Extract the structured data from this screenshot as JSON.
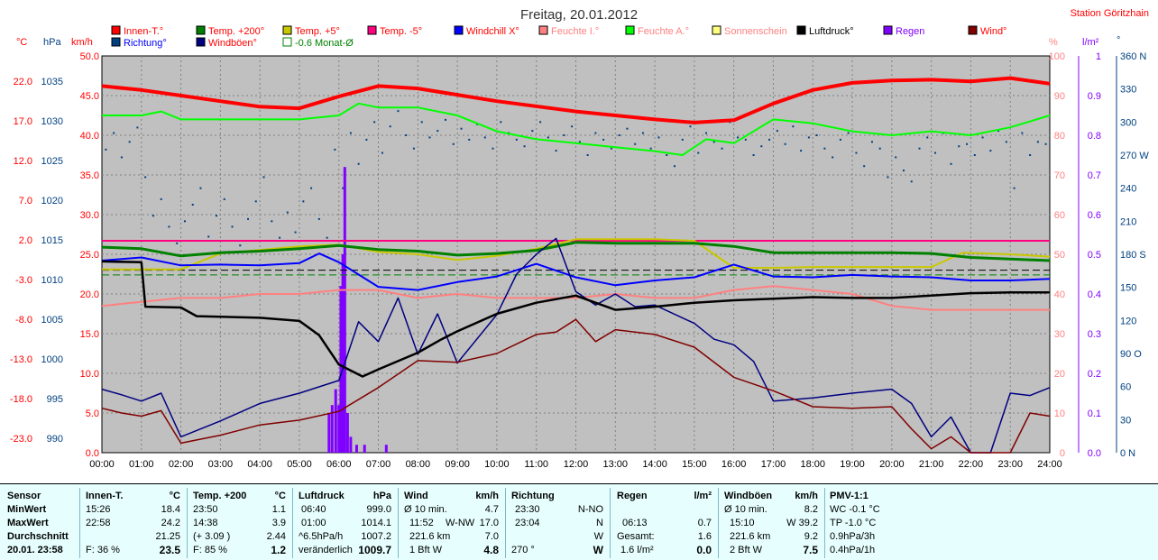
{
  "header": {
    "title": "Freitag, 20.01.2012",
    "station": "Station Göritzhain"
  },
  "colors": {
    "innen": "#ff0000",
    "temp200": "#008000",
    "temp5": "#c8c800",
    "temp_minus5": "#ff0080",
    "windchill": "#0000ff",
    "feuchte_i": "#ff8080",
    "feuchte_a": "#00ff00",
    "sonne": "#ffff80",
    "luftdruck": "#000000",
    "regen": "#8000ff",
    "wind": "#800000",
    "richtung": "#004080",
    "windboen": "#000080",
    "monat": "#008000",
    "axis_red": "#ff0000",
    "axis_blue": "#0000ff",
    "axis_navy": "#004080",
    "axis_violet": "#8000ff",
    "axis_pink": "#ff8080"
  },
  "legend": [
    {
      "label": "Innen-T.°",
      "color": "#ff0000",
      "text_color": "#ff0000"
    },
    {
      "label": "Temp. +200°",
      "color": "#008000",
      "text_color": "#ff0000"
    },
    {
      "label": "Temp. +5°",
      "color": "#c8c800",
      "text_color": "#ff0000"
    },
    {
      "label": "Temp. -5°",
      "color": "#ff0080",
      "text_color": "#ff0000"
    },
    {
      "label": "Windchill X°",
      "color": "#0000ff",
      "text_color": "#ff0000"
    },
    {
      "label": "Feuchte I.°",
      "color": "#ff8080",
      "text_color": "#ff8080"
    },
    {
      "label": "Feuchte A.°",
      "color": "#00ff00",
      "text_color": "#ff8080"
    },
    {
      "label": "Sonnenschein",
      "color": "#ffff80",
      "text_color": "#ff8080"
    },
    {
      "label": "Luftdruck°",
      "color": "#000000",
      "text_color": "#000000"
    },
    {
      "label": "Regen",
      "color": "#8000ff",
      "text_color": "#8000ff"
    },
    {
      "label": "Wind°",
      "color": "#800000",
      "text_color": "#ff0000"
    },
    {
      "label": "Richtung°",
      "color": "#004080",
      "text_color": "#0000ff"
    },
    {
      "label": "Windböen°",
      "color": "#000080",
      "text_color": "#ff0000"
    },
    {
      "label": "-0.6 Monat-Ø",
      "color": "#008000",
      "text_color": "#008000",
      "hollow": true
    }
  ],
  "unit_labels": {
    "c": "°C",
    "hpa": "hPa",
    "kmh": "km/h",
    "pct": "%",
    "lm2": "l/m²",
    "deg": "°"
  },
  "chart_data": {
    "type": "line",
    "title": "Freitag, 20.01.2012",
    "x_ticks": [
      "00:00",
      "01:00",
      "02:00",
      "03:00",
      "04:00",
      "05:00",
      "06:00",
      "07:00",
      "08:00",
      "09:00",
      "10:00",
      "11:00",
      "12:00",
      "13:00",
      "14:00",
      "15:00",
      "16:00",
      "17:00",
      "18:00",
      "19:00",
      "20:00",
      "21:00",
      "22:00",
      "23:00",
      "24:00"
    ],
    "axes": {
      "temp_c": {
        "min": -23.0,
        "max": 27.0,
        "ticks": [
          "22.0",
          "17.0",
          "12.0",
          "7.0",
          "2.0",
          "-3.0",
          "-8.0",
          "-13.0",
          "-18.0",
          "-23.0"
        ]
      },
      "pressure_hpa": {
        "min": 990,
        "max": 1040,
        "ticks": [
          "1035",
          "1030",
          "1025",
          "1020",
          "1015",
          "1010",
          "1005",
          "1000",
          "995",
          "990"
        ]
      },
      "wind_kmh": {
        "min": 0,
        "max": 50,
        "ticks": [
          "50.0",
          "45.0",
          "40.0",
          "35.0",
          "30.0",
          "25.0",
          "20.0",
          "15.0",
          "10.0",
          "5.0",
          "0.0"
        ]
      },
      "humidity_pct": {
        "min": 0,
        "max": 100,
        "ticks": [
          "100",
          "90",
          "80",
          "70",
          "60",
          "50",
          "40",
          "30",
          "20",
          "10",
          "0"
        ]
      },
      "rain_lm2": {
        "min": 0,
        "max": 1.0,
        "ticks": [
          "1",
          "0.9",
          "0.8",
          "0.7",
          "0.6",
          "0.5",
          "0.4",
          "0.3",
          "0.2",
          "0.1",
          "0.0"
        ]
      },
      "direction_deg": {
        "min": 0,
        "max": 360,
        "ticks": [
          "360 N",
          "330",
          "300",
          "270 W",
          "240",
          "210",
          "180 S",
          "150",
          "120",
          "90 O",
          "60",
          "30",
          "0 N"
        ]
      }
    },
    "series": [
      {
        "name": "Innen-T.°",
        "axis": "temp_c",
        "x": [
          0,
          1,
          2,
          3,
          4,
          5,
          6,
          7,
          8,
          10,
          12,
          14,
          15,
          16,
          17,
          18,
          19,
          20,
          21,
          22,
          23,
          24
        ],
        "y": [
          23.2,
          22.7,
          22.0,
          21.3,
          20.6,
          20.4,
          21.9,
          23.2,
          22.9,
          21.3,
          20.0,
          19.0,
          18.6,
          18.9,
          21.0,
          22.7,
          23.6,
          23.9,
          24.0,
          23.8,
          24.2,
          23.5
        ]
      },
      {
        "name": "Feuchte A.°",
        "axis": "humidity_pct",
        "x": [
          0,
          1,
          1.5,
          2,
          3,
          4,
          5,
          6,
          6.5,
          7,
          8,
          9,
          10,
          11,
          12,
          13,
          14,
          14.7,
          15.3,
          16,
          17,
          18,
          19,
          20,
          21,
          22,
          23,
          24
        ],
        "y": [
          85,
          85,
          86,
          84,
          84,
          84,
          84,
          85,
          88,
          87,
          87,
          85,
          81,
          79,
          78,
          77,
          76,
          75,
          79,
          78,
          84,
          83,
          81,
          80,
          81,
          80,
          82,
          85
        ]
      },
      {
        "name": "Temp. -5°",
        "axis": "temp_c",
        "x": [
          0,
          24
        ],
        "y": [
          3.7,
          3.7
        ]
      },
      {
        "name": "Temp. +5°",
        "axis": "temp_c",
        "x": [
          0,
          2,
          3,
          5,
          6,
          7,
          8,
          9,
          10,
          11,
          12,
          13,
          14,
          15,
          16,
          17,
          18,
          19,
          20,
          21,
          21.8,
          23,
          24
        ],
        "y": [
          0.1,
          0.1,
          2.1,
          3.0,
          3.2,
          2.3,
          2.0,
          1.3,
          1.8,
          2.7,
          3.9,
          3.9,
          3.9,
          3.7,
          0.3,
          0.3,
          0.4,
          0.4,
          0.4,
          0.4,
          2.2,
          2.0,
          1.7
        ]
      },
      {
        "name": "Temp. +200°",
        "axis": "temp_c",
        "x": [
          0,
          1,
          2,
          3,
          4,
          5,
          6,
          7,
          8,
          9,
          10,
          11,
          12,
          13,
          14,
          15,
          16,
          17,
          18,
          19,
          20,
          21,
          22,
          23,
          24
        ],
        "y": [
          2.9,
          2.7,
          1.8,
          2.2,
          2.4,
          2.7,
          3.1,
          2.6,
          2.4,
          1.9,
          2.1,
          2.5,
          3.5,
          3.4,
          3.4,
          3.4,
          3.0,
          2.2,
          2.2,
          2.2,
          2.2,
          2.1,
          1.6,
          1.4,
          1.2
        ]
      },
      {
        "name": "Windchill X°",
        "axis": "temp_c",
        "x": [
          0,
          1,
          2,
          3,
          4,
          5,
          5.5,
          6,
          7,
          8,
          9,
          10,
          11,
          12,
          13,
          14,
          15,
          16,
          17,
          18,
          19,
          20,
          21,
          22,
          23,
          24
        ],
        "y": [
          1.2,
          1.6,
          0.6,
          0.7,
          0.6,
          0.9,
          2.1,
          1.0,
          -2.1,
          -2.5,
          -1.5,
          -0.8,
          0.8,
          -0.9,
          -1.9,
          -1.3,
          -0.9,
          0.7,
          -0.8,
          -0.9,
          -0.6,
          -0.8,
          -0.9,
          -1.3,
          -1.3,
          -1.1
        ]
      },
      {
        "name": "Feuchte I.°",
        "axis": "humidity_pct",
        "x": [
          0,
          1,
          2,
          3,
          4,
          5,
          6,
          7,
          8,
          9,
          10,
          11,
          12,
          13,
          14,
          15,
          16,
          17,
          18,
          19,
          20,
          21,
          22,
          23,
          24
        ],
        "y": [
          37,
          38,
          39,
          39,
          40,
          40,
          41,
          41,
          39,
          40,
          39,
          39,
          39,
          40,
          39,
          39,
          41,
          42,
          41,
          40,
          37,
          36,
          36,
          36,
          36
        ]
      },
      {
        "name": "Luftdruck°",
        "axis": "pressure_hpa",
        "x": [
          0,
          1,
          1.1,
          2,
          2.4,
          4,
          5,
          5.5,
          6,
          6.6,
          7,
          8,
          8.6,
          9,
          10,
          11,
          12,
          13,
          14,
          15,
          16,
          17,
          18,
          19,
          20,
          21,
          22,
          23,
          24
        ],
        "y": [
          1014.1,
          1014.0,
          1008.4,
          1008.3,
          1007.2,
          1007.0,
          1006.6,
          1004.8,
          1001.1,
          999.6,
          1000.5,
          1002.6,
          1004.3,
          1005.3,
          1007.5,
          1008.9,
          1009.8,
          1008.0,
          1008.4,
          1008.9,
          1009.2,
          1009.4,
          1009.6,
          1009.5,
          1009.5,
          1009.8,
          1010.1,
          1010.2,
          1010.2
        ]
      },
      {
        "name": "Wind°",
        "axis": "wind_kmh",
        "x": [
          0,
          0.5,
          1,
          1.5,
          2,
          3,
          4,
          5,
          6,
          7,
          8,
          9,
          10,
          11,
          11.5,
          12,
          12.5,
          13,
          14,
          15,
          16,
          17,
          18,
          19,
          20,
          20.5,
          21,
          21.5,
          22,
          22.5,
          23,
          23.5,
          24
        ],
        "y": [
          5.6,
          5.0,
          4.6,
          5.3,
          1.2,
          2.2,
          3.5,
          4.1,
          5.2,
          8.2,
          11.6,
          11.4,
          12.5,
          14.9,
          15.2,
          16.8,
          14.0,
          15.5,
          14.9,
          13.3,
          9.5,
          7.8,
          5.8,
          5.6,
          5.8,
          3.0,
          0.5,
          2.0,
          0.0,
          0.0,
          0.0,
          5.0,
          4.6
        ]
      },
      {
        "name": "Windböen°",
        "axis": "wind_kmh",
        "x": [
          0,
          0.5,
          1,
          1.5,
          2,
          3,
          4,
          5,
          6,
          6.5,
          7,
          7.5,
          8,
          8.5,
          9,
          10,
          10.5,
          11,
          11.5,
          12,
          12.5,
          13,
          13.5,
          14,
          15,
          15.5,
          16,
          16.5,
          17,
          18,
          19,
          20,
          20.5,
          21,
          21.5,
          22,
          22.5,
          23,
          23.5,
          24
        ],
        "y": [
          8.0,
          7.3,
          6.5,
          7.5,
          2.0,
          4.0,
          6.2,
          7.5,
          9.1,
          16.5,
          14.0,
          19.5,
          12.4,
          17.5,
          11.3,
          17.4,
          22.5,
          25.0,
          27.0,
          20.3,
          18.6,
          20.0,
          18.4,
          18.6,
          16.3,
          14.3,
          13.6,
          11.5,
          6.5,
          6.9,
          7.5,
          8.0,
          6.2,
          2.0,
          4.5,
          0.0,
          0.0,
          7.5,
          7.2,
          8.2
        ]
      },
      {
        "name": "Regen",
        "axis": "rain_lm2",
        "type": "bar",
        "x": [
          5.75,
          5.83,
          5.92,
          6.0,
          6.05,
          6.1,
          6.15,
          6.22,
          6.3,
          6.45,
          6.65,
          7.2
        ],
        "y": [
          0.1,
          0.12,
          0.16,
          0.12,
          0.42,
          0.5,
          0.72,
          0.1,
          0.04,
          0.02,
          0.02,
          0.02
        ]
      },
      {
        "name": "-0.6 Monat-Ø",
        "axis": "temp_c",
        "type": "reference",
        "y": -0.6
      }
    ],
    "richtung_x": [
      0.1,
      0.3,
      0.5,
      0.7,
      0.9,
      1.1,
      1.3,
      1.5,
      1.7,
      1.9,
      2.1,
      2.3,
      2.5,
      2.7,
      2.9,
      3.1,
      3.3,
      3.5,
      3.7,
      3.9,
      4.1,
      4.3,
      4.5,
      4.7,
      4.9,
      5.1,
      5.3,
      5.5,
      5.7,
      5.9,
      6.1,
      6.3,
      6.5,
      6.7,
      6.9,
      7.1,
      7.3,
      7.5,
      7.7,
      7.9,
      8.1,
      8.3,
      8.5,
      8.7,
      8.9,
      9.1,
      9.3,
      9.5,
      9.7,
      9.9,
      10.1,
      10.3,
      10.5,
      10.7,
      10.9,
      11.1,
      11.3,
      11.5,
      11.7,
      11.9,
      12.1,
      12.3,
      12.5,
      12.7,
      12.9,
      13.1,
      13.3,
      13.5,
      13.7,
      13.9,
      14.1,
      14.3,
      14.5,
      14.7,
      14.9,
      15.1,
      15.3,
      15.5,
      15.7,
      15.9,
      16.1,
      16.3,
      16.5,
      16.7,
      16.9,
      17.1,
      17.3,
      17.5,
      17.7,
      17.9,
      18.1,
      18.3,
      18.5,
      18.7,
      18.9,
      19.1,
      19.3,
      19.5,
      19.7,
      19.9,
      20.1,
      20.3,
      20.5,
      20.7,
      20.9,
      21.1,
      21.3,
      21.5,
      21.7,
      21.9,
      22.1,
      22.3,
      22.5,
      22.7,
      22.9,
      23.1,
      23.3,
      23.5,
      23.7,
      23.9
    ],
    "richtung_deg": [
      275,
      290,
      268,
      282,
      295,
      250,
      215,
      230,
      205,
      190,
      210,
      225,
      240,
      196,
      215,
      230,
      205,
      188,
      212,
      228,
      250,
      210,
      195,
      218,
      200,
      228,
      240,
      212,
      195,
      275,
      240,
      290,
      262,
      284,
      300,
      272,
      296,
      310,
      288,
      276,
      300,
      286,
      292,
      302,
      280,
      294,
      284,
      298,
      286,
      276,
      300,
      290,
      284,
      278,
      292,
      300,
      286,
      274,
      288,
      296,
      282,
      270,
      290,
      284,
      276,
      288,
      294,
      280,
      290,
      276,
      286,
      270,
      260,
      284,
      296,
      272,
      290,
      282,
      276,
      300,
      286,
      284,
      270,
      278,
      284,
      292,
      280,
      296,
      274,
      286,
      288,
      276,
      268,
      284,
      290,
      272,
      260,
      282,
      276,
      250,
      268,
      256,
      246,
      276,
      286,
      272,
      290,
      262,
      278,
      280,
      270,
      286,
      274,
      292,
      282,
      240,
      290,
      270,
      282,
      280
    ]
  },
  "stats": {
    "sensor": {
      "title": "Sensor",
      "min": "MinWert",
      "max": "MaxWert",
      "avg": "Durchschnitt",
      "now": "20.01. 23:58"
    },
    "innen": {
      "title": "Innen-T.",
      "unit": "°C",
      "min_t": "15:26",
      "min_v": "18.4",
      "max_t": "22:58",
      "max_v": "24.2",
      "avg_v": "21.25",
      "now_l": "F: 36 %",
      "now_v": "23.5"
    },
    "temp200": {
      "title": "Temp. +200",
      "unit": "°C",
      "min_t": "23:50",
      "min_v": "1.1",
      "max_t": "14:38",
      "max_v": "3.9",
      "avg_t": "(+ 3.09 )",
      "avg_v": "2.44",
      "now_l": "F: 85 %",
      "now_v": "1.2"
    },
    "luftdruck": {
      "title": "Luftdruck",
      "unit": "hPa",
      "min_t": "06:40",
      "min_v": "999.0",
      "max_t": "01:00",
      "max_v": "1014.1",
      "avg_t": "^6.5hPa/h",
      "avg_v": "1007.2",
      "now_l": "veränderlich",
      "now_v": "1009.7"
    },
    "wind": {
      "title": "Wind",
      "unit": "km/h",
      "min_t": "Ø 10 min.",
      "min_v": "4.7",
      "max_t": "11:52",
      "max_d": "W-NW",
      "max_v": "17.0",
      "avg_t": "221.6 km",
      "avg_v": "7.0",
      "now_l": "1 Bft W",
      "now_v": "4.8"
    },
    "richtung": {
      "title": "Richtung",
      "min_t": "23:30",
      "min_v": "N-NO",
      "max_t": "23:04",
      "max_v": "N",
      "avg_v": "W",
      "now_l": "270 °",
      "now_v": "W"
    },
    "regen": {
      "title": "Regen",
      "unit": "l/m²",
      "max_t": "06:13",
      "max_v": "0.7",
      "avg_t": "Gesamt:",
      "avg_v": "1.6",
      "now_l": "1.6 l/m²",
      "now_v": "0.0"
    },
    "windboen": {
      "title": "Windböen",
      "unit": "km/h",
      "min_t": "Ø 10 min.",
      "min_v": "8.2",
      "max_t": "15:10",
      "max_v": "W 39.2",
      "avg_t": "221.6 km",
      "avg_v": "9.2",
      "now_l": "2 Bft W",
      "now_v": "7.5"
    },
    "pmv": {
      "title": "PMV-1:1",
      "l1": "WC -0.1 °C",
      "l2": "TP -1.0 °C",
      "l3": "0.9hPa/3h",
      "l4": "0.4hPa/1h"
    }
  }
}
